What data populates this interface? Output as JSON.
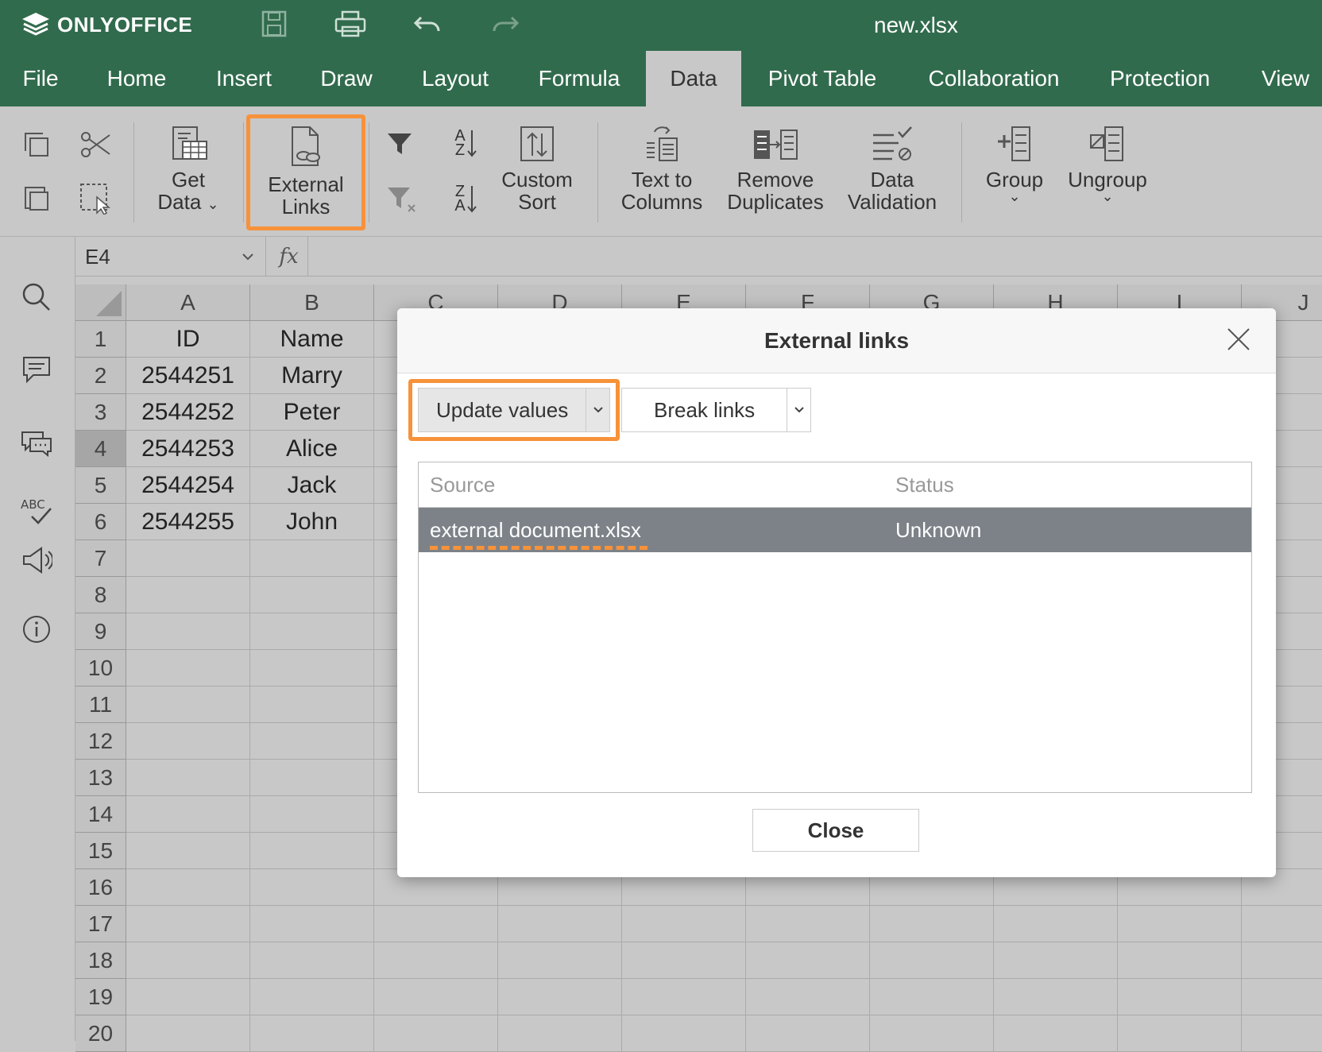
{
  "app": {
    "brand": "ONLYOFFICE",
    "doc_title": "new.xlsx"
  },
  "menu": {
    "tabs": [
      "File",
      "Home",
      "Insert",
      "Draw",
      "Layout",
      "Formula",
      "Data",
      "Pivot Table",
      "Collaboration",
      "Protection",
      "View"
    ],
    "active": "Data"
  },
  "toolbar": {
    "get_data": [
      "Get",
      "Data"
    ],
    "external_links": [
      "External",
      "Links"
    ],
    "custom_sort": [
      "Custom",
      "Sort"
    ],
    "text_to_columns": [
      "Text to",
      "Columns"
    ],
    "remove_duplicates": [
      "Remove",
      "Duplicates"
    ],
    "data_validation": [
      "Data",
      "Validation"
    ],
    "group": "Group",
    "ungroup": "Ungroup",
    "sort_az": [
      "A",
      "Z"
    ],
    "sort_za": [
      "Z",
      "A"
    ]
  },
  "formula": {
    "cell_ref": "E4",
    "fx": "fx"
  },
  "grid": {
    "columns": [
      "A",
      "B",
      "C",
      "D",
      "E",
      "F",
      "G",
      "H",
      "I",
      "J"
    ],
    "rows": [
      "1",
      "2",
      "3",
      "4",
      "5",
      "6",
      "7",
      "8",
      "9",
      "10",
      "11",
      "12",
      "13",
      "14",
      "15",
      "16",
      "17",
      "18",
      "19",
      "20"
    ],
    "selected_row": "4",
    "cells": [
      [
        "ID",
        "Name"
      ],
      [
        "2544251",
        "Marry"
      ],
      [
        "2544252",
        "Peter"
      ],
      [
        "2544253",
        "Alice"
      ],
      [
        "2544254",
        "Jack"
      ],
      [
        "2544255",
        "John"
      ]
    ]
  },
  "dialog": {
    "title": "External links",
    "update_values": "Update values",
    "break_links": "Break links",
    "col_source": "Source",
    "col_status": "Status",
    "rows": [
      {
        "source": "external document.xlsx",
        "status": "Unknown"
      }
    ],
    "close": "Close"
  },
  "colors": {
    "brand_green": "#316b4d",
    "highlight_orange": "#f7923a",
    "selected_row": "#7d8288"
  }
}
